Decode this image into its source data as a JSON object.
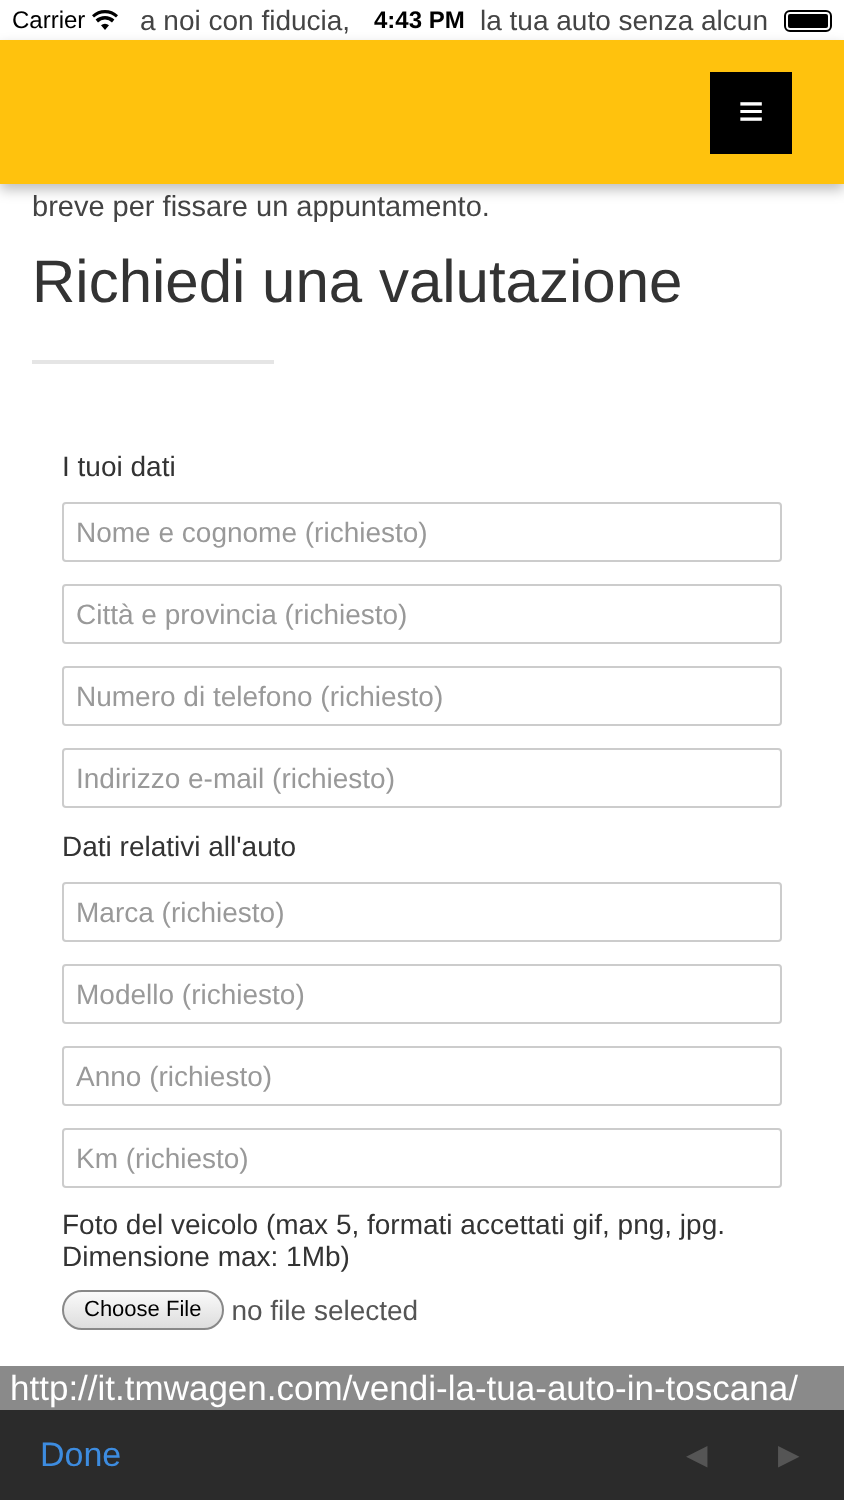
{
  "status_bar": {
    "carrier": "Carrier",
    "time": "4:43 PM"
  },
  "intro_first_line_fragments": [
    "a noi con fiducia,",
    "la tua auto senza alcun"
  ],
  "intro_lines": [
    "breve per fissare un appuntamento."
  ],
  "header": {
    "menu_icon": "≡"
  },
  "heading": "Richiedi una valutazione",
  "sections": [
    {
      "title": "I tuoi dati",
      "fields": [
        {
          "placeholder": "Nome e cognome (richiesto)"
        },
        {
          "placeholder": "Città e provincia (richiesto)"
        },
        {
          "placeholder": "Numero di telefono (richiesto)"
        },
        {
          "placeholder": "Indirizzo e-mail (richiesto)"
        }
      ]
    },
    {
      "title": "Dati relativi all'auto",
      "fields": [
        {
          "placeholder": "Marca (richiesto)"
        },
        {
          "placeholder": "Modello (richiesto)"
        },
        {
          "placeholder": "Anno (richiesto)"
        },
        {
          "placeholder": "Km (richiesto)"
        }
      ]
    }
  ],
  "photos": {
    "label": "Foto del veicolo (max 5, formati accettati gif, png, jpg. Dimensione max: 1Mb)",
    "inputs": [
      {
        "button": "Choose File",
        "status": "no file selected"
      }
    ]
  },
  "url_bar": "http://it.tmwagen.com/vendi-la-tua-auto-in-toscana/",
  "toolbar": {
    "done": "Done",
    "back": "◀",
    "forward": "▶",
    "back_disabled": true,
    "forward_disabled": true
  }
}
